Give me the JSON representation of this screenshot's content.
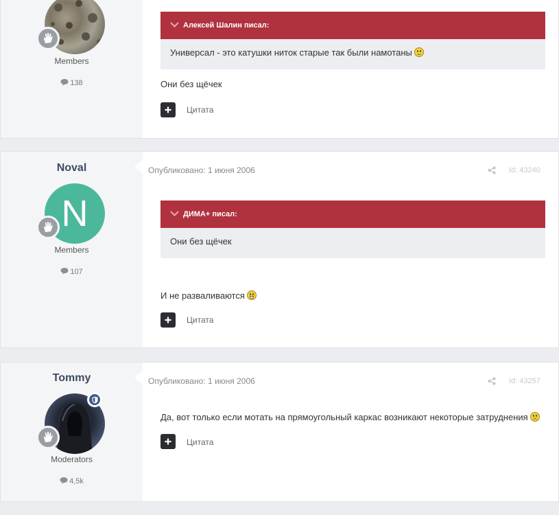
{
  "posts": [
    {
      "group": "Members",
      "count": "138",
      "quote": {
        "author": "Алексей Шалин писал:",
        "text": "Универсал - это катушки ниток старые так были намотаны"
      },
      "text": "Они без щёчек",
      "quote_label": "Цитата"
    },
    {
      "username": "Noval",
      "avatar_letter": "N",
      "group": "Members",
      "count": "107",
      "date": "Опубликовано: 1 июня 2006",
      "id": "Id: 43240",
      "quote": {
        "author": "ДИМА+ писал:",
        "text": "Они без щёчек"
      },
      "text": "И не разваливаются",
      "quote_label": "Цитата"
    },
    {
      "username": "Tommy",
      "group": "Moderators",
      "count": "4,5k",
      "date": "Опубликовано: 1 июня 2006",
      "id": "Id: 43257",
      "text": "Да, вот только если мотать на прямоугольный каркас возникают некоторые затруднения",
      "quote_label": "Цитата"
    }
  ],
  "colors": {
    "quote_header": "#b0323e",
    "avatar_n": "#4cb89b",
    "moderator_badge": "#3d5a8a"
  },
  "icons": [
    "chevron-down-icon",
    "share-icon",
    "comment-icon",
    "plus-icon",
    "hand-badge-icon",
    "shield-icon",
    "smile-icon"
  ]
}
